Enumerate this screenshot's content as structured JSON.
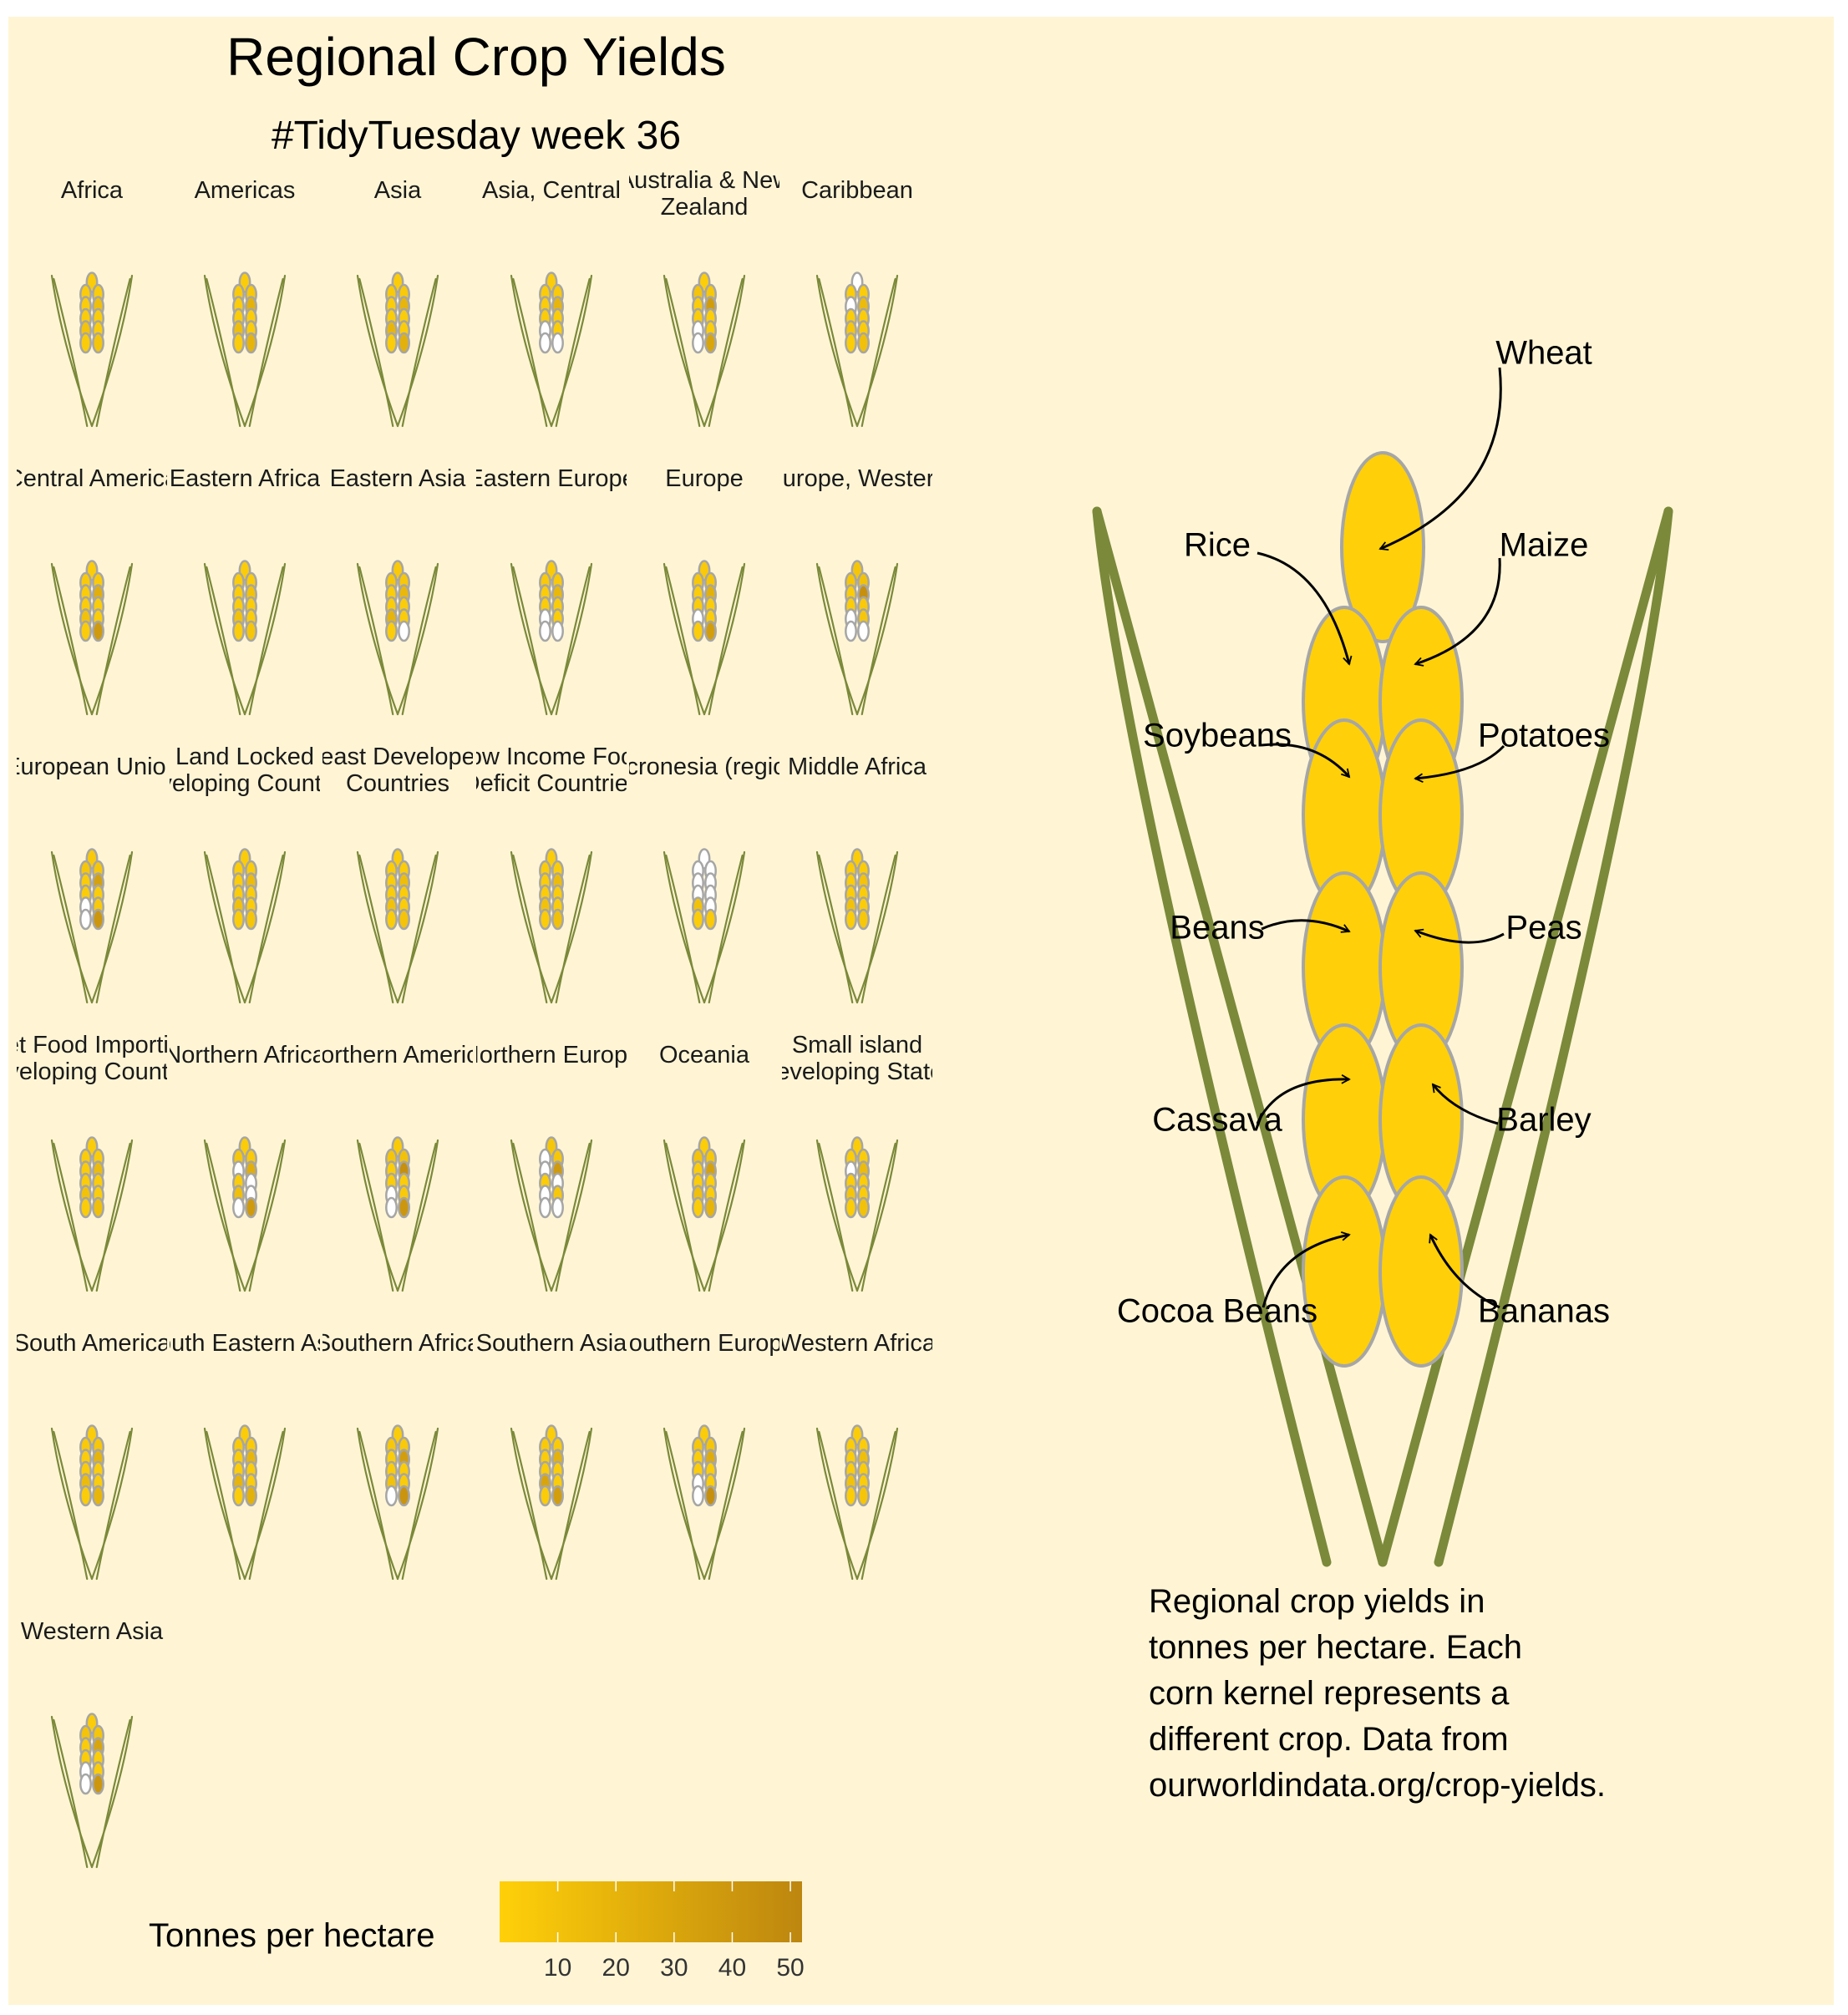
{
  "title": "Regional Crop Yields",
  "subtitle": "#TidyTuesday week 36",
  "legend": {
    "title": "Tonnes per hectare",
    "ticks": [
      10,
      20,
      30,
      40,
      50
    ],
    "range": [
      0,
      52
    ],
    "color_low": "#FFD009",
    "color_high": "#BD860F",
    "missing_color": "#ffffff",
    "position": "bottom"
  },
  "caption_lines": [
    "Regional crop yields in",
    "tonnes per hectare. Each",
    "corn kernel represents a",
    "different crop. Data from",
    "ourworldindata.org/crop-yields."
  ],
  "colors": {
    "background": "#FFF5D5",
    "leaf": "#7B893A",
    "kernel_stroke": "#A6A6A6",
    "key_kernel": "#FFD009"
  },
  "key": {
    "crops": [
      "Wheat",
      "Rice",
      "Maize",
      "Soybeans",
      "Potatoes",
      "Beans",
      "Peas",
      "Cassava",
      "Barley",
      "Cocoa Beans",
      "Bananas"
    ]
  },
  "chart_data": {
    "type": "pictogram-facets",
    "value_unit": "tonnes per hectare",
    "kernel_order": [
      "Wheat",
      "Rice",
      "Maize",
      "Soybeans",
      "Potatoes",
      "Beans",
      "Peas",
      "Cassava",
      "Barley",
      "Cocoa Beans",
      "Bananas"
    ],
    "note": "null = no data (white kernel); values approximate, read from colour scale",
    "facets": [
      {
        "label": [
          "Africa"
        ],
        "values": [
          3,
          3,
          3,
          3,
          12,
          3,
          3,
          9,
          3,
          3,
          8
        ]
      },
      {
        "label": [
          "Americas"
        ],
        "values": [
          3,
          4,
          6,
          3,
          21,
          3,
          3,
          13,
          3,
          3,
          20
        ]
      },
      {
        "label": [
          "Asia"
        ],
        "values": [
          3,
          4,
          5,
          3,
          19,
          3,
          3,
          18,
          3,
          3,
          22
        ]
      },
      {
        "label": [
          "Asia, Central"
        ],
        "values": [
          3,
          3,
          5,
          3,
          19,
          3,
          3,
          null,
          3,
          null,
          null
        ]
      },
      {
        "label": [
          "Australia & New",
          "Zealand"
        ],
        "values": [
          2,
          9,
          6,
          3,
          36,
          3,
          2,
          null,
          3,
          null,
          30
        ]
      },
      {
        "label": [
          "Caribbean"
        ],
        "values": [
          null,
          3,
          3,
          null,
          15,
          3,
          3,
          7,
          3,
          3,
          11
        ]
      },
      {
        "label": [
          "Central America"
        ],
        "values": [
          3,
          4,
          4,
          3,
          24,
          3,
          3,
          10,
          3,
          3,
          38
        ]
      },
      {
        "label": [
          "Eastern Africa"
        ],
        "values": [
          3,
          3,
          3,
          3,
          10,
          3,
          3,
          10,
          3,
          3,
          8
        ]
      },
      {
        "label": [
          "Eastern Asia"
        ],
        "values": [
          5,
          6,
          6,
          3,
          17,
          3,
          3,
          20,
          3,
          3,
          null
        ]
      },
      {
        "label": [
          "Eastern Europe"
        ],
        "values": [
          4,
          5,
          5,
          3,
          17,
          3,
          3,
          null,
          3,
          null,
          null
        ]
      },
      {
        "label": [
          "Europe"
        ],
        "values": [
          5,
          6,
          7,
          3,
          22,
          3,
          3,
          null,
          3,
          3,
          35
        ]
      },
      {
        "label": [
          "Europe, Western"
        ],
        "values": [
          8,
          7,
          10,
          3,
          45,
          3,
          5,
          null,
          7,
          null,
          null
        ]
      },
      {
        "label": [
          "European Union"
        ],
        "values": [
          5,
          7,
          7,
          3,
          33,
          3,
          3,
          null,
          5,
          null,
          40
        ]
      },
      {
        "label": [
          "Land Locked",
          "Developing Countries"
        ],
        "values": [
          3,
          3,
          3,
          3,
          14,
          3,
          3,
          11,
          3,
          3,
          8
        ]
      },
      {
        "label": [
          "Least Developed",
          "Countries"
        ],
        "values": [
          3,
          3,
          3,
          3,
          13,
          3,
          3,
          10,
          3,
          3,
          9
        ]
      },
      {
        "label": [
          "Low Income Food",
          "Deficit Countries"
        ],
        "values": [
          3,
          3,
          3,
          3,
          14,
          3,
          3,
          10,
          3,
          3,
          11
        ]
      },
      {
        "label": [
          "Micronesia (region)"
        ],
        "values": [
          null,
          null,
          null,
          null,
          null,
          null,
          null,
          10,
          null,
          3,
          5
        ]
      },
      {
        "label": [
          "Middle Africa"
        ],
        "values": [
          3,
          3,
          3,
          3,
          9,
          3,
          3,
          10,
          3,
          3,
          6
        ]
      },
      {
        "label": [
          "Net Food Importing",
          "Developing Countries"
        ],
        "values": [
          3,
          3,
          3,
          3,
          15,
          3,
          3,
          10,
          3,
          3,
          12
        ]
      },
      {
        "label": [
          "Northern Africa"
        ],
        "values": [
          3,
          6,
          5,
          null,
          24,
          3,
          null,
          12,
          null,
          null,
          38
        ]
      },
      {
        "label": [
          "Northern America"
        ],
        "values": [
          4,
          8,
          10,
          3,
          45,
          3,
          3,
          null,
          4,
          null,
          40
        ]
      },
      {
        "label": [
          "Northern Europe"
        ],
        "values": [
          7,
          null,
          7,
          null,
          38,
          3,
          null,
          null,
          6,
          null,
          null
        ]
      },
      {
        "label": [
          "Oceania"
        ],
        "values": [
          2,
          9,
          6,
          3,
          33,
          3,
          2,
          12,
          3,
          3,
          20
        ]
      },
      {
        "label": [
          "Small island",
          "Developing States"
        ],
        "values": [
          3,
          3,
          3,
          null,
          15,
          3,
          3,
          8,
          3,
          3,
          10
        ]
      },
      {
        "label": [
          "South America"
        ],
        "values": [
          3,
          5,
          6,
          3,
          20,
          3,
          3,
          14,
          3,
          3,
          18
        ]
      },
      {
        "label": [
          "South Eastern Asia"
        ],
        "values": [
          3,
          4,
          4,
          3,
          18,
          3,
          3,
          20,
          3,
          3,
          22
        ]
      },
      {
        "label": [
          "Southern Africa"
        ],
        "values": [
          3,
          6,
          5,
          3,
          35,
          3,
          3,
          10,
          3,
          null,
          42
        ]
      },
      {
        "label": [
          "Southern Asia"
        ],
        "values": [
          3,
          4,
          4,
          3,
          21,
          3,
          3,
          30,
          3,
          3,
          35
        ]
      },
      {
        "label": [
          "Southern Europe"
        ],
        "values": [
          3,
          6,
          8,
          3,
          25,
          3,
          3,
          null,
          3,
          null,
          45
        ]
      },
      {
        "label": [
          "Western Africa"
        ],
        "values": [
          3,
          3,
          3,
          3,
          12,
          3,
          3,
          10,
          3,
          3,
          8
        ]
      },
      {
        "label": [
          "Western Asia"
        ],
        "values": [
          3,
          9,
          8,
          3,
          30,
          3,
          3,
          null,
          3,
          null,
          40
        ]
      }
    ]
  }
}
